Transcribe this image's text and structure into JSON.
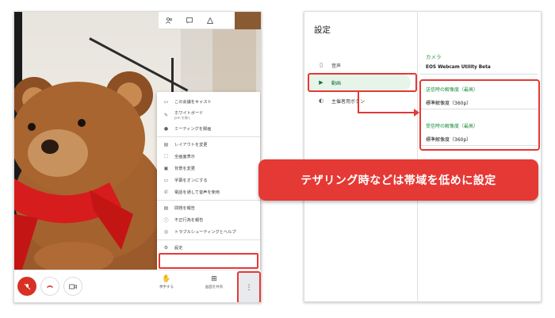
{
  "meeting": {
    "top_icons": [
      "people-icon",
      "chat-icon",
      "activities-icon"
    ],
    "menu": {
      "items": [
        {
          "icon": "cast-icon",
          "label": "この会議をキャスト",
          "sub": ""
        },
        {
          "icon": "whiteboard-icon",
          "label": "ホワイトボード",
          "sub": "Jam を開く"
        },
        {
          "icon": "record-icon",
          "label": "ミーティングを録画",
          "sub": ""
        },
        {
          "icon": "layout-icon",
          "label": "レイアウトを変更",
          "sub": ""
        },
        {
          "icon": "fullscreen-icon",
          "label": "全画面表示",
          "sub": ""
        },
        {
          "icon": "background-icon",
          "label": "背景を変更",
          "sub": ""
        },
        {
          "icon": "captions-icon",
          "label": "字幕をオンにする",
          "sub": ""
        },
        {
          "icon": "phone-icon",
          "label": "電話を通して音声を使用",
          "sub": ""
        },
        {
          "icon": "report-problem-icon",
          "label": "問題を報告",
          "sub": ""
        },
        {
          "icon": "report-abuse-icon",
          "label": "不正行為を報告",
          "sub": ""
        },
        {
          "icon": "troubleshoot-icon",
          "label": "トラブルシューティングとヘルプ",
          "sub": ""
        },
        {
          "icon": "settings-icon",
          "label": "設定",
          "sub": ""
        }
      ]
    },
    "controls": {
      "raise_hand": "挙手する",
      "present": "画面を共有",
      "more": "⋮"
    }
  },
  "settings": {
    "title": "設定",
    "nav": [
      {
        "icon": "speaker-icon",
        "label": "音声"
      },
      {
        "icon": "video-icon",
        "label": "動画"
      },
      {
        "icon": "toggle-icon",
        "label": "主催者用ボタン"
      }
    ],
    "camera_label": "カメラ",
    "camera_value": "EOS Webcam Utility Beta",
    "send_label": "送信時の解像度（最高）",
    "send_value": "標準解像度（360p）",
    "receive_label": "受信時の解像度（最高）",
    "receive_value": "標準解像度（360p）"
  },
  "callout": {
    "text": "テザリング時などは帯域を低めに設定"
  },
  "colors": {
    "highlight": "#e53935",
    "accent_green": "#1e8e3e",
    "mic_off_red": "#d93025"
  }
}
